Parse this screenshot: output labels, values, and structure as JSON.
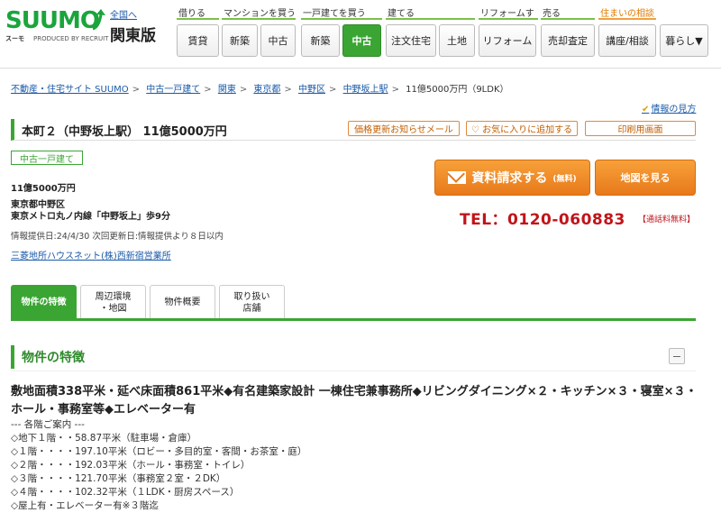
{
  "header": {
    "logo_text": "SUUMO",
    "logo_kana": "スーモ",
    "logo_produced": "PRODUCED BY RECRUIT",
    "region_link": "全国へ",
    "region_name": "関東版",
    "nav": [
      {
        "label": "借りる",
        "buttons": [
          "賃貸"
        ]
      },
      {
        "label": "マンションを買う",
        "buttons": [
          "新築",
          "中古"
        ]
      },
      {
        "label": "一戸建てを買う",
        "buttons": [
          "新築",
          "中古"
        ]
      },
      {
        "label": "建てる",
        "buttons": [
          "注文住宅",
          "土地"
        ]
      },
      {
        "label": "リフォームす",
        "buttons": [
          "リフォーム"
        ]
      },
      {
        "label": "売る",
        "buttons": [
          "売却査定"
        ]
      },
      {
        "label": "住まいの相談",
        "buttons": [
          "講座/相談"
        ]
      },
      {
        "label": "",
        "buttons": [
          "暮らし▼"
        ]
      }
    ]
  },
  "breadcrumb": [
    "不動産・住宅サイト SUUMO",
    "中古一戸建て",
    "関東",
    "東京都",
    "中野区",
    "中野坂上駅",
    "11億5000万円（9LDK）"
  ],
  "info_guide": "情報の見方",
  "title": "本町２（中野坂上駅）  11億5000万円",
  "action_buttons": {
    "price_mail": "価格更新お知らせメール",
    "favorite": "♡ お気に入りに追加する",
    "print": "印刷用画面"
  },
  "property_tag": "中古一戸建て",
  "price": "11億5000万円",
  "address": "東京都中野区",
  "access": "東京メトロ丸ノ内線「中野坂上」歩9分",
  "info_dates": "情報提供日:24/4/30 次回更新日:情報提供より８日以内",
  "company": "三菱地所ハウスネット(株)西新宿営業所",
  "request_button": {
    "main": "資料請求する",
    "sub": "(無料)"
  },
  "map_button": "地図を見る",
  "tel": "TEL：0120-060883",
  "tel_free": "【通話料無料】",
  "tabs": [
    "物件の特徴",
    "周辺環境\n・地図",
    "物件概要",
    "取り扱い\n店舗"
  ],
  "section_title": "物件の特徴",
  "feature_headline": "敷地面積338平米・延べ床面積861平米◆有名建築家設計 一棟住宅兼事務所◆リビングダイニング×２・キッチン×３・寝室×３・ホール・事務室等◆エレベーター有",
  "feature_lines": [
    "--- 各階ご案内 ---",
    "◇地下１階・・58.87平米（駐車場・倉庫）",
    "◇１階・・・・197.10平米（ロビー・多目的室・客間・お茶室・庭）",
    "◇２階・・・・192.03平米（ホール・事務室・トイレ）",
    "◇３階・・・・121.70平米（事務室２室・２DK）",
    "◇４階・・・・102.32平米（１LDK・厨房スペース）",
    "◇屋上有・エレベーター有※３階迄"
  ]
}
